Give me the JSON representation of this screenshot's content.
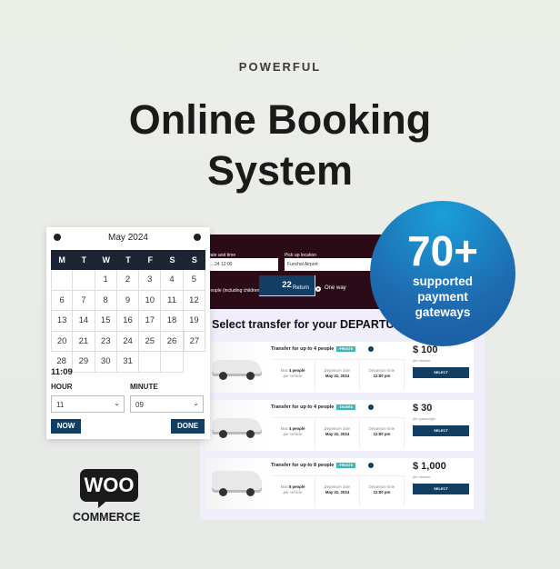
{
  "hero": {
    "eyebrow": "POWERFUL",
    "title_line1": "Online Booking",
    "title_line2": "System"
  },
  "booking": {
    "date_label": "Date and time",
    "date_value": "…24 12:00",
    "pickup_label": "Pick up location",
    "pickup_value": "Funchal Airport",
    "people_label": "People (including children)?",
    "return_label": "Return",
    "oneway_label": "One way",
    "section_title": "Select transfer for your DEPARTURE",
    "cards": [
      {
        "title": "Transfer for up to 4 people",
        "badge": "PRIVATE",
        "max_pre": "Max ",
        "max": "4 people",
        "max_sub": "per vehicle",
        "date_label": "Departure date",
        "date": "May 31, 2024",
        "time_label": "Departure time",
        "time": "12:00 pm",
        "price": "$ 100",
        "per": "per vehicle",
        "select": "SELECT"
      },
      {
        "title": "Transfer for up to 4 people",
        "badge": "SHARED",
        "max_pre": "Max ",
        "max": "4 people",
        "max_sub": "per vehicle",
        "date_label": "Departure date",
        "date": "May 31, 2024",
        "time_label": "Departure time",
        "time": "12:00 pm",
        "price": "$ 30",
        "per": "per passenger",
        "select": "SELECT"
      },
      {
        "title": "Transfer for up to 8 people",
        "badge": "PRIVATE",
        "max_pre": "Max ",
        "max": "8 people",
        "max_sub": "per vehicle",
        "date_label": "Departure date",
        "date": "May 31, 2024",
        "time_label": "Departure time",
        "time": "12:00 pm",
        "price": "$ 1,000",
        "per": "per vehicle",
        "select": "SELECT"
      }
    ]
  },
  "badge": {
    "number": "70+",
    "line1": "supported",
    "line2": "payment",
    "line3": "gateways"
  },
  "calendar": {
    "month": "May 2024",
    "weekdays": [
      "M",
      "T",
      "W",
      "T",
      "F",
      "S",
      "S"
    ],
    "days": [
      "",
      "",
      "1",
      "2",
      "3",
      "4",
      "5",
      "6",
      "7",
      "8",
      "9",
      "10",
      "11",
      "12",
      "13",
      "14",
      "15",
      "16",
      "17",
      "18",
      "19",
      "20",
      "21",
      "22",
      "23",
      "24",
      "25",
      "26",
      "27",
      "28",
      "29",
      "30",
      "31",
      "",
      ""
    ],
    "selected": "22",
    "time": "11:09",
    "hour_label": "HOUR",
    "minute_label": "MINUTE",
    "hour": "11",
    "minute": "09",
    "now": "NOW",
    "done": "DONE"
  },
  "logo": {
    "woo": "WOO",
    "commerce": "COMMERCE"
  }
}
